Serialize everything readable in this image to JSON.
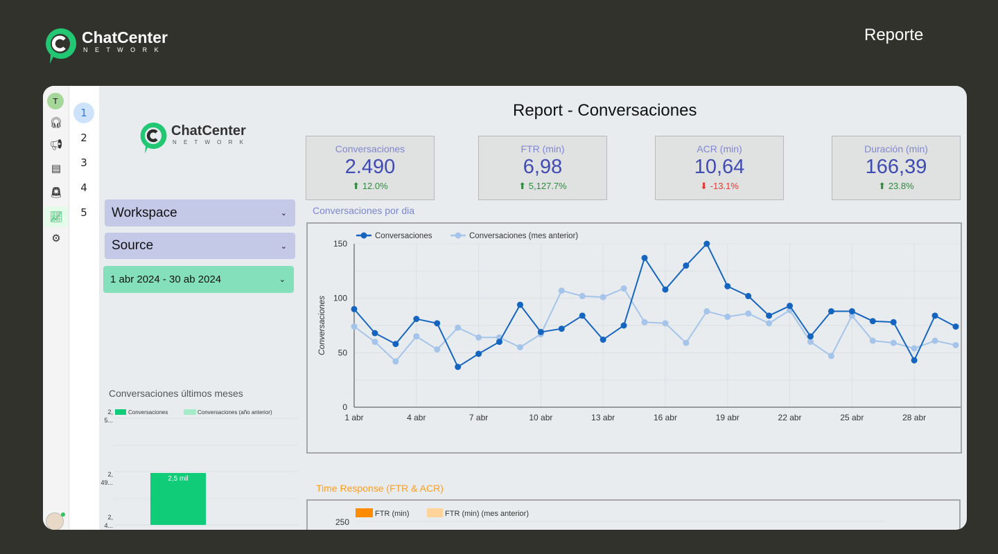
{
  "header": {
    "brand": "ChatCenter",
    "brand_sub": "N E T W O R K",
    "title": "Reporte"
  },
  "rail": {
    "avatar": "T",
    "icons": [
      "headset-icon",
      "megaphone-icon",
      "database-icon",
      "alarm-icon",
      "chart-icon",
      "gear-icon"
    ],
    "active": "chart-icon"
  },
  "pages": [
    "1",
    "2",
    "3",
    "4",
    "5"
  ],
  "report": {
    "title": "Report - Conversaciones",
    "brand": "ChatCenter",
    "brand_sub": "N E T W O R K"
  },
  "filters": {
    "workspace": "Workspace",
    "source": "Source",
    "date": "1 abr 2024 - 30 ab 2024"
  },
  "kpis": [
    {
      "label": "Conversaciones",
      "value": "2.490",
      "delta": "12.0%",
      "trend": "up"
    },
    {
      "label": "FTR (min)",
      "value": "6,98",
      "delta": "5,127.7%",
      "trend": "up"
    },
    {
      "label": "ACR (min)",
      "value": "10,64",
      "delta": "-13.1%",
      "trend": "down"
    },
    {
      "label": "Duración (min)",
      "value": "166,39",
      "delta": "23.8%",
      "trend": "up"
    }
  ],
  "colors": {
    "up": "#2e8b3e",
    "down": "#e53935",
    "series_main": "#1565c0",
    "series_prev": "#a4c4ea",
    "bar": "#10cc78",
    "bar_prev": "#a3ecc8",
    "ftr": "#ff8c00",
    "ftr_prev": "#ffd49a"
  },
  "chart_data": [
    {
      "type": "line",
      "title": "Conversaciones por dia",
      "ylabel": "Conversaciones",
      "ylim": [
        0,
        150
      ],
      "yticks": [
        "0",
        "50",
        "100",
        "150"
      ],
      "x": [
        1,
        2,
        3,
        4,
        5,
        6,
        7,
        8,
        9,
        10,
        11,
        12,
        13,
        14,
        15,
        16,
        17,
        18,
        19,
        20,
        21,
        22,
        23,
        24,
        25,
        26,
        27,
        28,
        29,
        30
      ],
      "xtick_labels": [
        "1 abr",
        "4 abr",
        "7 abr",
        "10 abr",
        "13 abr",
        "16 abr",
        "19 abr",
        "22 abr",
        "25 abr",
        "28 abr"
      ],
      "grid": true,
      "legend": "top-left",
      "series": [
        {
          "name": "Conversaciones",
          "values": [
            90,
            68,
            58,
            81,
            77,
            37,
            49,
            60,
            94,
            69,
            72,
            84,
            62,
            75,
            137,
            108,
            130,
            150,
            111,
            102,
            84,
            93,
            65,
            88,
            88,
            79,
            78,
            43,
            84,
            74
          ]
        },
        {
          "name": "Conversaciones (mes anterior)",
          "values": [
            74,
            60,
            42,
            65,
            53,
            73,
            64,
            64,
            55,
            67,
            107,
            102,
            101,
            109,
            78,
            77,
            59,
            88,
            83,
            86,
            77,
            89,
            60,
            47,
            84,
            61,
            59,
            54,
            61,
            57
          ]
        }
      ]
    },
    {
      "type": "bar",
      "title": "Conversaciones últimos meses",
      "yticks": [
        "2, 5...",
        "2, 49...",
        "2, 4..."
      ],
      "legend": "top-left",
      "series": [
        {
          "name": "Conversaciones",
          "values": [
            2490
          ]
        },
        {
          "name": "Conversaciones (año anterior)",
          "values": []
        }
      ],
      "data_labels": [
        "2,5 mil"
      ]
    },
    {
      "type": "bar",
      "title": "Time Response (FTR & ACR)",
      "yticks": [
        "250"
      ],
      "legend": "top-left",
      "series": [
        {
          "name": "FTR (min)"
        },
        {
          "name": "FTR (min) (mes anterior)"
        }
      ]
    }
  ]
}
